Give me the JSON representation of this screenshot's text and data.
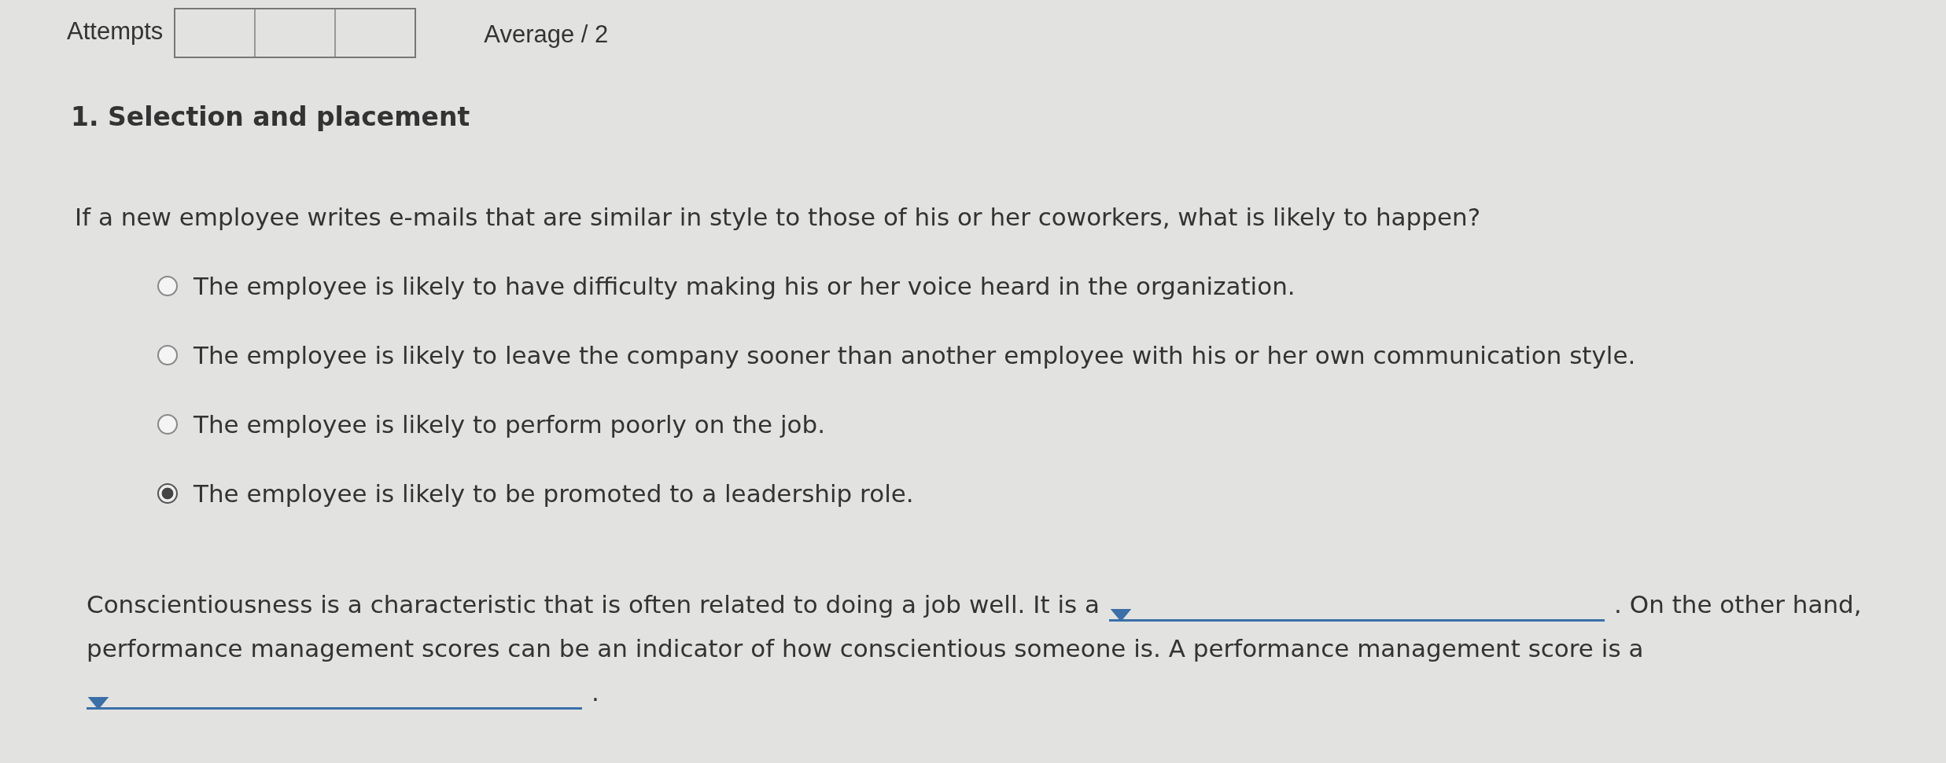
{
  "header": {
    "attempts_label": "Attempts",
    "average": "Average / 2"
  },
  "question": {
    "title": "1. Selection and placement",
    "prompt": "If a new employee writes e-mails that are similar in style to those of his or her coworkers, what is likely to happen?",
    "options": [
      {
        "label": "The employee is likely to have difficulty making his or her voice heard in the organization.",
        "selected": false
      },
      {
        "label": "The employee is likely to leave the company sooner than another employee with his or her own communication style.",
        "selected": false
      },
      {
        "label": "The employee is likely to perform poorly on the job.",
        "selected": false
      },
      {
        "label": "The employee is likely to be promoted to a leadership role.",
        "selected": true
      }
    ]
  },
  "passage": [
    {
      "kind": "text",
      "text": "Conscientiousness is a characteristic that is often related to doing a job well. It is a"
    },
    {
      "kind": "dropdown"
    },
    {
      "kind": "text",
      "text": ". On the other hand,"
    },
    {
      "kind": "text",
      "text": "performance management scores can be an indicator of how conscientious someone is. A performance management score is a"
    },
    {
      "kind": "dropdown"
    },
    {
      "kind": "text",
      "text": "."
    }
  ]
}
